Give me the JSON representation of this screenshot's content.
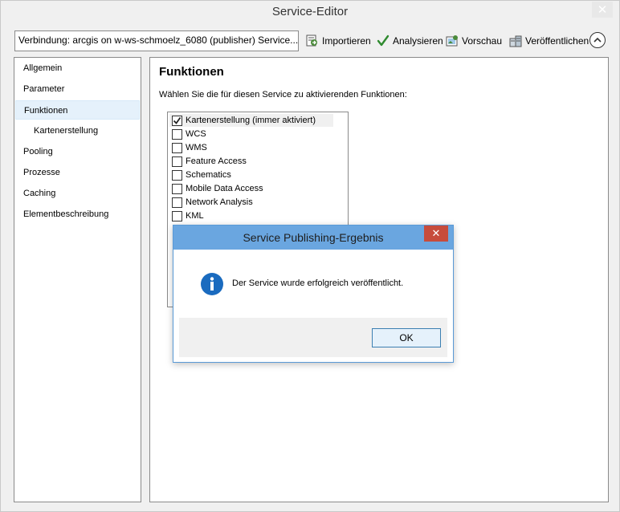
{
  "window": {
    "title": "Service-Editor",
    "close_glyph": "✕"
  },
  "toolbar": {
    "connection": "Verbindung: arcgis on w-ws-schmoelz_6080 (publisher)   Service...",
    "import_label": "Importieren",
    "analyze_label": "Analysieren",
    "preview_label": "Vorschau",
    "publish_label": "Veröffentlichen",
    "icons": [
      "import-icon",
      "checkmark-icon",
      "preview-icon",
      "publish-icon",
      "chevron-up-icon"
    ]
  },
  "sidebar": {
    "items": [
      {
        "label": "Allgemein"
      },
      {
        "label": "Parameter"
      },
      {
        "label": "Funktionen",
        "selected": true
      },
      {
        "label": "Kartenerstellung",
        "sub": true
      },
      {
        "label": "Pooling"
      },
      {
        "label": "Prozesse"
      },
      {
        "label": "Caching"
      },
      {
        "label": "Elementbeschreibung"
      }
    ]
  },
  "main": {
    "heading": "Funktionen",
    "description": "Wählen Sie die für diesen Service zu aktivierenden Funktionen:",
    "functions": [
      {
        "label": "Kartenerstellung (immer aktiviert)",
        "checked": true
      },
      {
        "label": "WCS",
        "checked": false
      },
      {
        "label": "WMS",
        "checked": false
      },
      {
        "label": "Feature Access",
        "checked": false
      },
      {
        "label": "Schematics",
        "checked": false
      },
      {
        "label": "Mobile Data Access",
        "checked": false
      },
      {
        "label": "Network Analysis",
        "checked": false
      },
      {
        "label": "KML",
        "checked": false
      }
    ]
  },
  "dialog": {
    "title": "Service Publishing-Ergebnis",
    "close_glyph": "✕",
    "message": "Der Service wurde erfolgreich veröffentlicht.",
    "ok_label": "OK",
    "icon": "info-icon"
  },
  "colors": {
    "dialog_title_bg": "#6aa6e0",
    "dialog_close_bg": "#c74c3c",
    "selection_bg": "#e5f1fb",
    "info_icon": "#1a6bbf"
  }
}
